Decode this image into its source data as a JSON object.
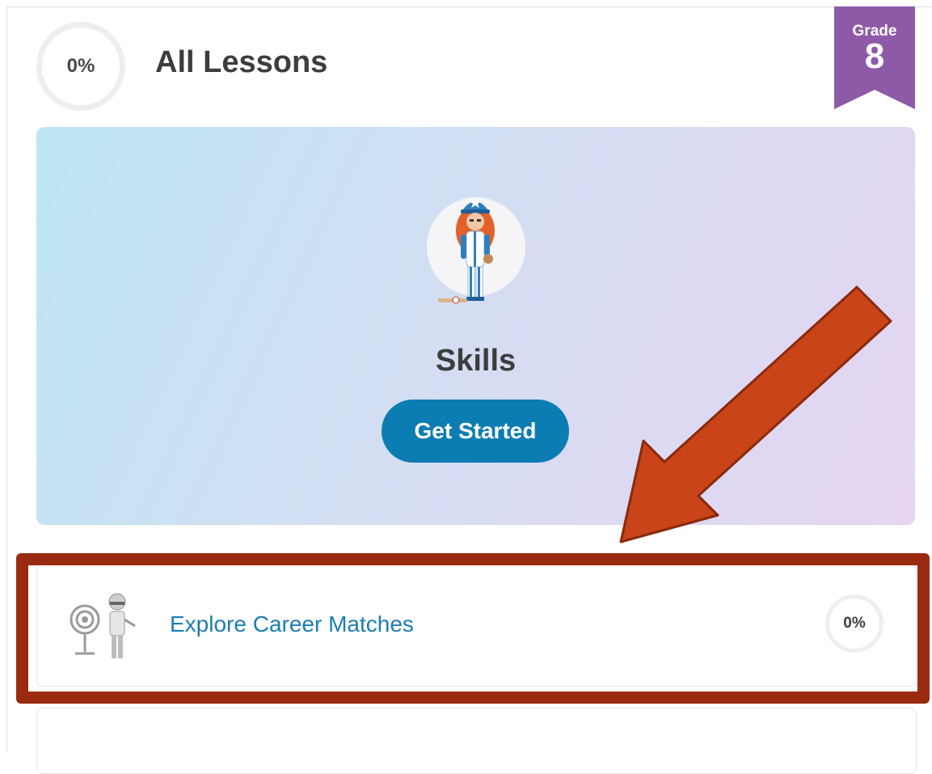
{
  "header": {
    "progress": "0%",
    "title": "All Lessons",
    "grade_label": "Grade",
    "grade_value": "8"
  },
  "skills_card": {
    "title": "Skills",
    "button_label": "Get Started"
  },
  "lessons": [
    {
      "title": "Explore Career Matches",
      "progress": "0%"
    }
  ],
  "colors": {
    "accent": "#0b7db3",
    "grade_ribbon": "#8e5aa8",
    "link": "#1d7db3",
    "annotation": "#c94418"
  },
  "icons": [
    "avatar-baseball-player-icon",
    "career-target-icon",
    "grade-ribbon-icon",
    "annotation-arrow-icon"
  ]
}
